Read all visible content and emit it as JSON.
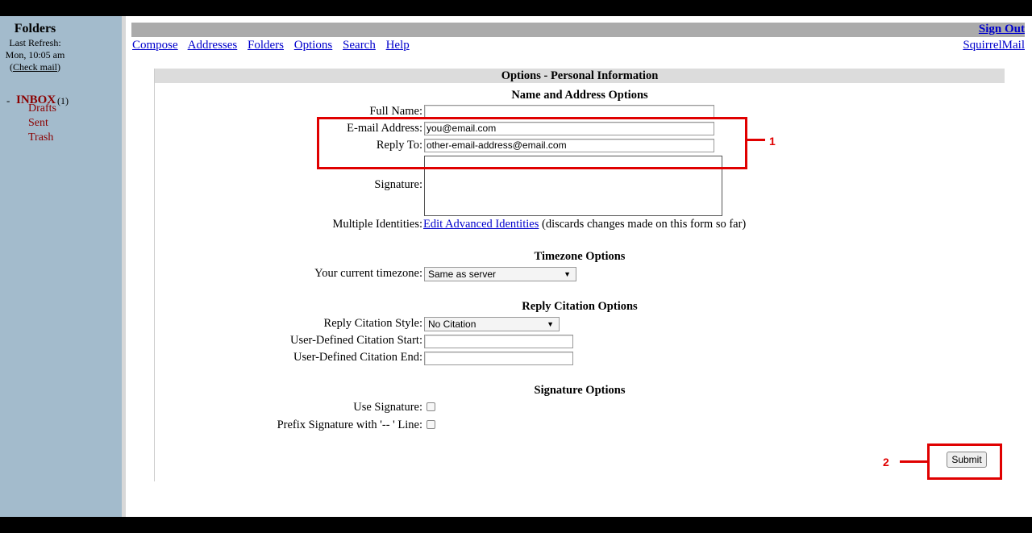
{
  "sidebar": {
    "title": "Folders",
    "last_refresh_label": "Last Refresh:",
    "last_refresh_time": "Mon, 10:05 am",
    "check_mail_open": "(",
    "check_mail": "Check mail",
    "check_mail_close": ")",
    "inbox_dash": "-",
    "folders": [
      {
        "label": "INBOX",
        "count": "(1)"
      },
      {
        "label": "Drafts"
      },
      {
        "label": "Sent"
      },
      {
        "label": "Trash"
      }
    ]
  },
  "header": {
    "sign_out": "Sign Out",
    "app_name": "SquirrelMail",
    "nav": [
      "Compose",
      "Addresses",
      "Folders",
      "Options",
      "Search",
      "Help"
    ]
  },
  "panel": {
    "title": "Options - Personal Information",
    "name_address": {
      "heading": "Name and Address Options",
      "full_name_label": "Full Name:",
      "full_name_value": "",
      "email_label": "E-mail Address:",
      "email_value": "you@email.com",
      "reply_to_label": "Reply To:",
      "reply_to_value": "other-email-address@email.com",
      "signature_label": "Signature:",
      "identities_label": "Multiple Identities:",
      "identities_link": "Edit Advanced Identities",
      "identities_note": "(discards changes made on this form so far)"
    },
    "timezone": {
      "heading": "Timezone Options",
      "label": "Your current timezone:",
      "value": "Same as server"
    },
    "citation": {
      "heading": "Reply Citation Options",
      "style_label": "Reply Citation Style:",
      "style_value": "No Citation",
      "start_label": "User-Defined Citation Start:",
      "end_label": "User-Defined Citation End:"
    },
    "signature_opts": {
      "heading": "Signature Options",
      "use_label": "Use Signature:",
      "prefix_label": "Prefix Signature with '-- ' Line:"
    },
    "submit": "Submit"
  },
  "annotations": {
    "callout_1": "1",
    "callout_2": "2",
    "color": "#e00000"
  },
  "colors": {
    "sidebar_bg": "#a3bbcc",
    "folder_link": "#8b0000",
    "link": "#0000cc",
    "title_bar": "#ababab"
  }
}
